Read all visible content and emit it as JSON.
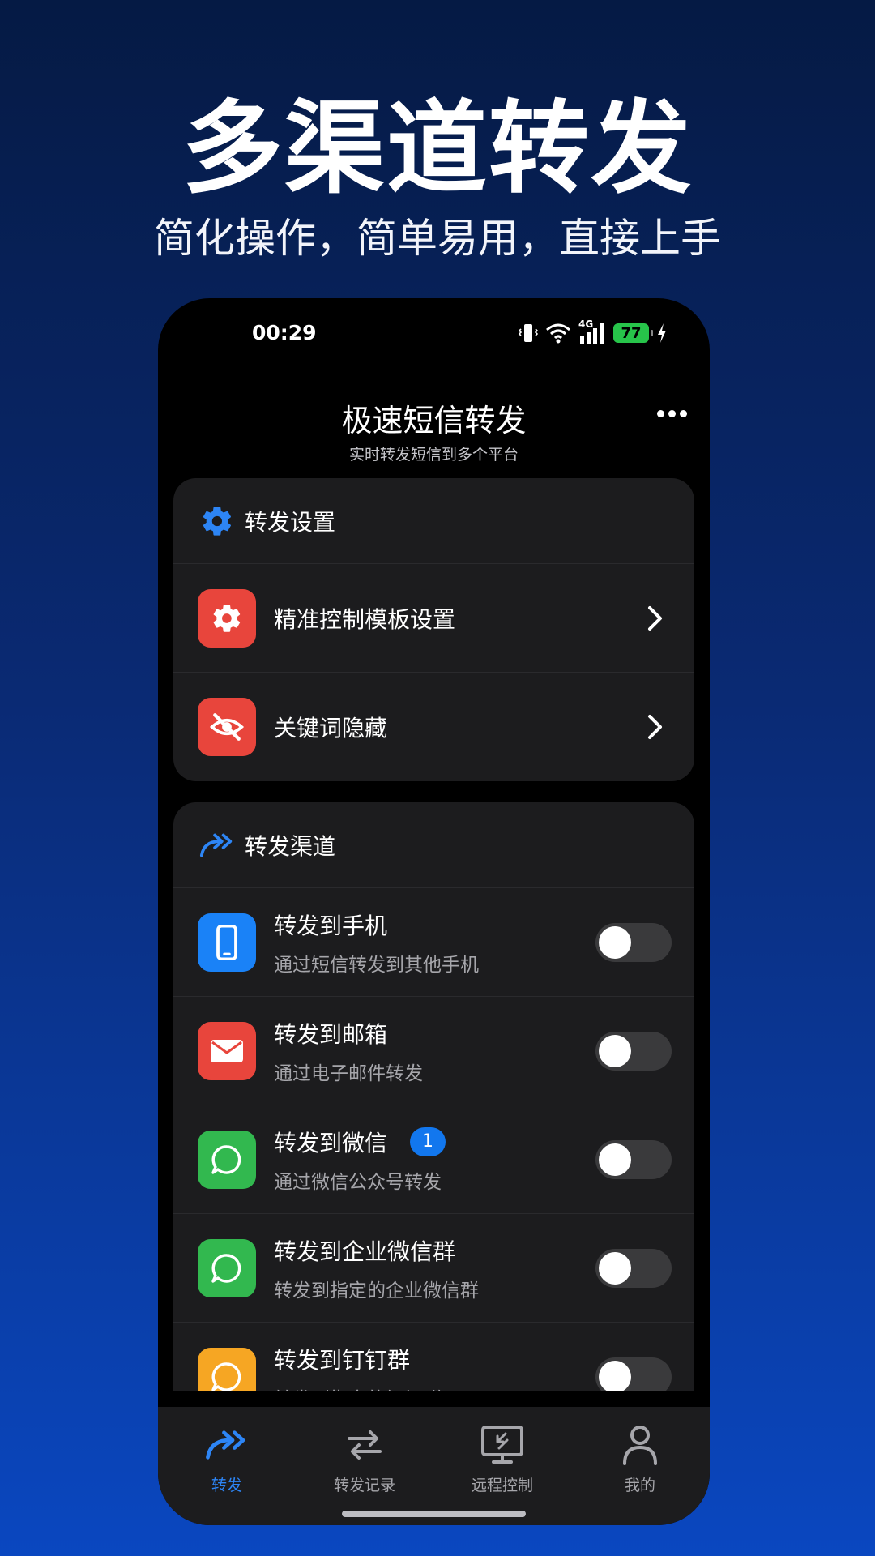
{
  "promo": {
    "title": "多渠道转发",
    "subtitle": "简化操作，简单易用，直接上手"
  },
  "status_bar": {
    "time": "00:29",
    "network": "4G",
    "battery": "77"
  },
  "header": {
    "title": "极速短信转发",
    "subtitle": "实时转发短信到多个平台",
    "more_icon": "more-horizontal-icon"
  },
  "settings_card": {
    "title": "转发设置",
    "icon": "gear-icon",
    "items": [
      {
        "label": "精准控制模板设置",
        "icon": "gear-icon",
        "color": "#e8453c"
      },
      {
        "label": "关键词隐藏",
        "icon": "eye-off-icon",
        "color": "#e8453c"
      }
    ]
  },
  "channels_card": {
    "title": "转发渠道",
    "icon": "forward-arrows-icon",
    "items": [
      {
        "label": "转发到手机",
        "desc": "通过短信转发到其他手机",
        "icon": "phone-icon",
        "color": "#1a82f7",
        "enabled": false
      },
      {
        "label": "转发到邮箱",
        "desc": "通过电子邮件转发",
        "icon": "mail-icon",
        "color": "#e8453c",
        "enabled": false
      },
      {
        "label": "转发到微信",
        "desc": "通过微信公众号转发",
        "icon": "chat-bubble-icon",
        "color": "#32b84f",
        "badge": "1",
        "enabled": false
      },
      {
        "label": "转发到企业微信群",
        "desc": "转发到指定的企业微信群",
        "icon": "chat-bubble-icon",
        "color": "#32b84f",
        "enabled": false
      },
      {
        "label": "转发到钉钉群",
        "desc": "转发到指定的钉钉群",
        "icon": "chat-bubble-icon",
        "color": "#f6a623",
        "enabled": false
      }
    ]
  },
  "tab_bar": {
    "tabs": [
      {
        "label": "转发",
        "icon": "forward-arrows-icon",
        "active": true
      },
      {
        "label": "转发记录",
        "icon": "swap-arrows-icon",
        "active": false
      },
      {
        "label": "远程控制",
        "icon": "remote-desktop-icon",
        "active": false
      },
      {
        "label": "我的",
        "icon": "person-icon",
        "active": false
      }
    ]
  },
  "colors": {
    "accent": "#2d85f5",
    "card": "#1c1c1e",
    "toggle_off": "#3a3a3c"
  }
}
